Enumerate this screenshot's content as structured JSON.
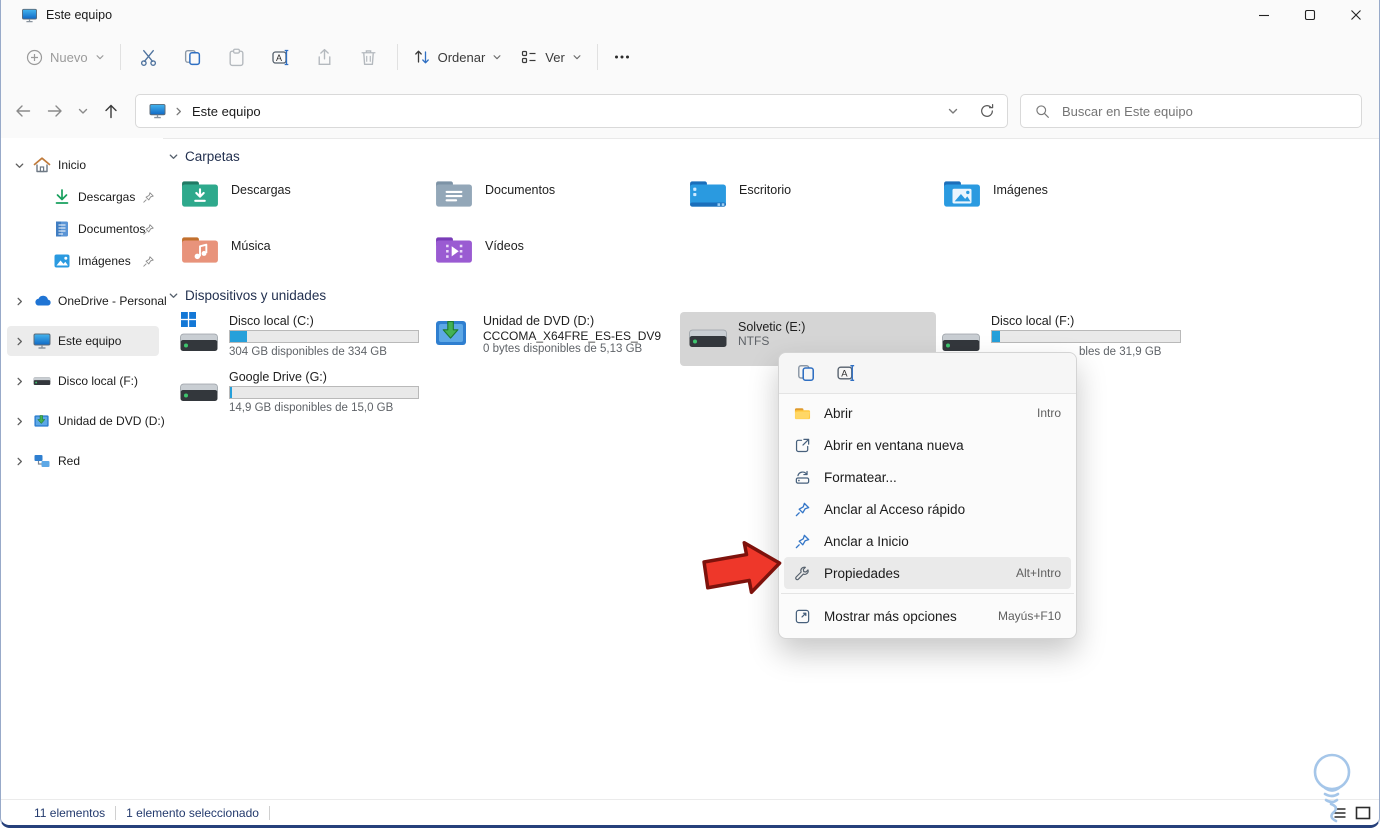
{
  "window": {
    "title": "Este equipo"
  },
  "toolbar": {
    "new_label": "Nuevo",
    "sort_label": "Ordenar",
    "view_label": "Ver"
  },
  "navbar": {
    "breadcrumb": "Este equipo",
    "search_placeholder": "Buscar en Este equipo"
  },
  "sidebar": {
    "items": [
      {
        "label": "Inicio"
      },
      {
        "label": "Descargas"
      },
      {
        "label": "Documentos"
      },
      {
        "label": "Imágenes"
      },
      {
        "label": "OneDrive - Personal"
      },
      {
        "label": "Este equipo"
      },
      {
        "label": "Disco local (F:)"
      },
      {
        "label": "Unidad de DVD (D:)"
      },
      {
        "label": "Red"
      }
    ]
  },
  "main": {
    "groups": [
      {
        "title": "Carpetas"
      },
      {
        "title": "Dispositivos y unidades"
      }
    ],
    "folders": [
      {
        "name": "Descargas"
      },
      {
        "name": "Documentos"
      },
      {
        "name": "Escritorio"
      },
      {
        "name": "Imágenes"
      },
      {
        "name": "Música"
      },
      {
        "name": "Vídeos"
      }
    ],
    "drives": [
      {
        "name": "Disco local (C:)",
        "info": "304 GB disponibles de 334 GB",
        "used_pct": 9
      },
      {
        "name": "Unidad de DVD (D:)",
        "line2": "CCCOMA_X64FRE_ES-ES_DV9",
        "info": "0 bytes disponibles de 5,13 GB"
      },
      {
        "name": "Solvetic (E:)",
        "fs": "NTFS"
      },
      {
        "name": "Disco local (F:)",
        "info_visible": "bles de 31,9 GB",
        "used_pct": 4
      },
      {
        "name": "Google Drive (G:)",
        "info": "14,9 GB disponibles de 15,0 GB",
        "used_pct": 1
      }
    ]
  },
  "context_menu": {
    "items": [
      {
        "label": "Abrir",
        "shortcut": "Intro"
      },
      {
        "label": "Abrir en ventana nueva",
        "shortcut": ""
      },
      {
        "label": "Formatear...",
        "shortcut": ""
      },
      {
        "label": "Anclar al Acceso rápido",
        "shortcut": ""
      },
      {
        "label": "Anclar a Inicio",
        "shortcut": ""
      },
      {
        "label": "Propiedades",
        "shortcut": "Alt+Intro"
      },
      {
        "label": "Mostrar más opciones",
        "shortcut": "Mayús+F10"
      }
    ]
  },
  "statusbar": {
    "items_count": "11 elementos",
    "selected_count": "1 elemento seleccionado"
  },
  "icon_names": [
    "this-pc-icon",
    "minimize-icon",
    "maximize-icon",
    "close-icon",
    "plus-icon",
    "cut-icon",
    "copy-icon",
    "paste-icon",
    "rename-icon",
    "share-icon",
    "delete-icon",
    "sort-icon",
    "view-icon",
    "more-icon",
    "back-icon",
    "forward-icon",
    "recent-icon",
    "up-icon",
    "refresh-icon",
    "search-icon",
    "home-icon",
    "download-icon",
    "document-icon",
    "picture-icon",
    "onedrive-cloud-icon",
    "hdd-icon",
    "dvd-icon",
    "network-icon",
    "pin-icon",
    "folder-open-icon",
    "open-new-window-icon",
    "format-icon",
    "wrench-icon",
    "show-more-icon",
    "red-arrow",
    "lightbulb-watermark",
    "details-view-icon",
    "thumbnail-view-icon"
  ],
  "colors": {
    "accent_blue": "#26a0da",
    "selection_gray": "#d5d5d5",
    "arrow_red": "#ee372a",
    "window_border": "#26407b"
  }
}
